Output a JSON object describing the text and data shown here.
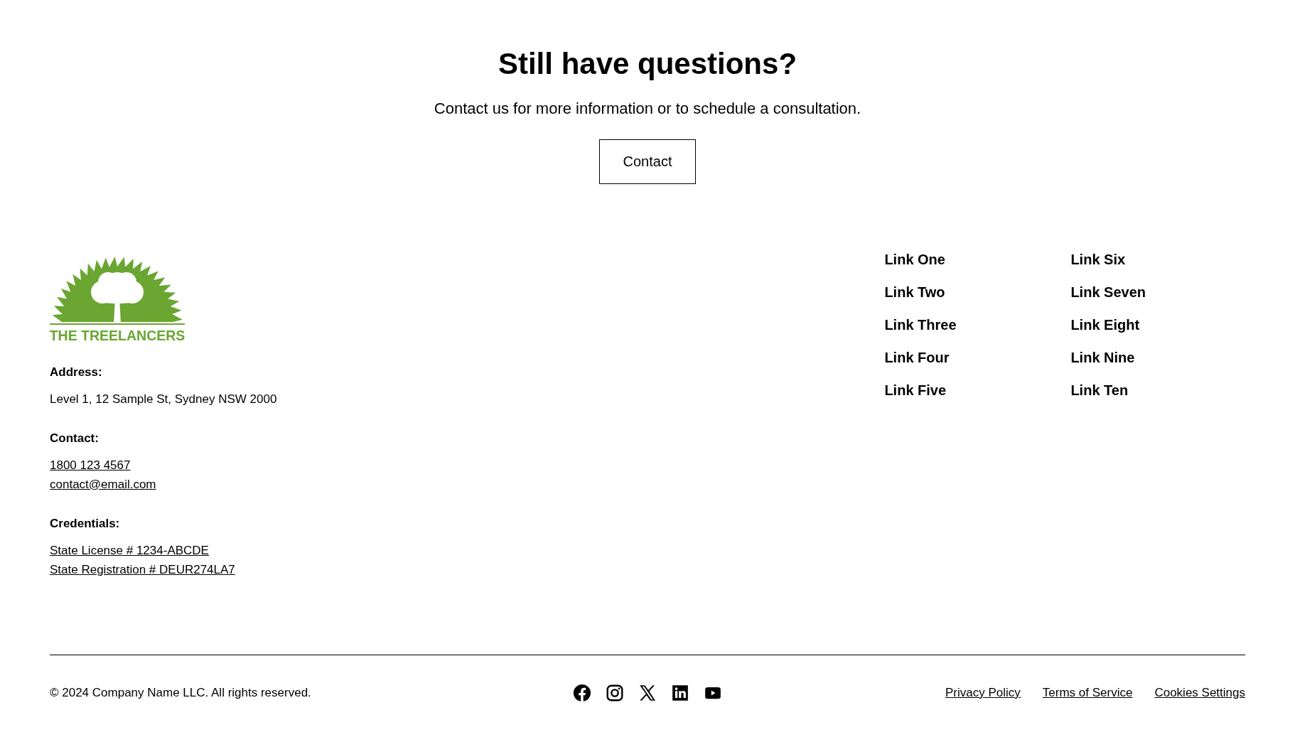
{
  "cta": {
    "title": "Still have questions?",
    "text": "Contact us for more information or to schedule a consultation.",
    "button": "Contact"
  },
  "footer": {
    "logo_text": "THE TREELANCERS",
    "info": [
      {
        "label": "Address:",
        "lines": [
          {
            "text": "Level 1, 12 Sample St, Sydney NSW 2000",
            "kind": "text"
          }
        ]
      },
      {
        "label": "Contact:",
        "lines": [
          {
            "text": "1800 123 4567",
            "kind": "link"
          },
          {
            "text": "contact@email.com",
            "kind": "link"
          }
        ]
      },
      {
        "label": "Credentials:",
        "lines": [
          {
            "text": "State License # 1234-ABCDE",
            "kind": "link"
          },
          {
            "text": "State Registration # DEUR274LA7",
            "kind": "link"
          }
        ]
      }
    ],
    "link_columns": [
      [
        "Link One",
        "Link Two",
        "Link Three",
        "Link Four",
        "Link Five"
      ],
      [
        "Link Six",
        "Link Seven",
        "Link Eight",
        "Link Nine",
        "Link Ten"
      ]
    ]
  },
  "bottom": {
    "copyright": "© 2024 Company Name LLC. All rights reserved.",
    "social": [
      {
        "kind": "facebook"
      },
      {
        "kind": "instagram"
      },
      {
        "kind": "x"
      },
      {
        "kind": "linkedin"
      },
      {
        "kind": "youtube"
      }
    ],
    "legal_links": [
      "Privacy Policy",
      "Terms of Service",
      "Cookies Settings"
    ]
  }
}
